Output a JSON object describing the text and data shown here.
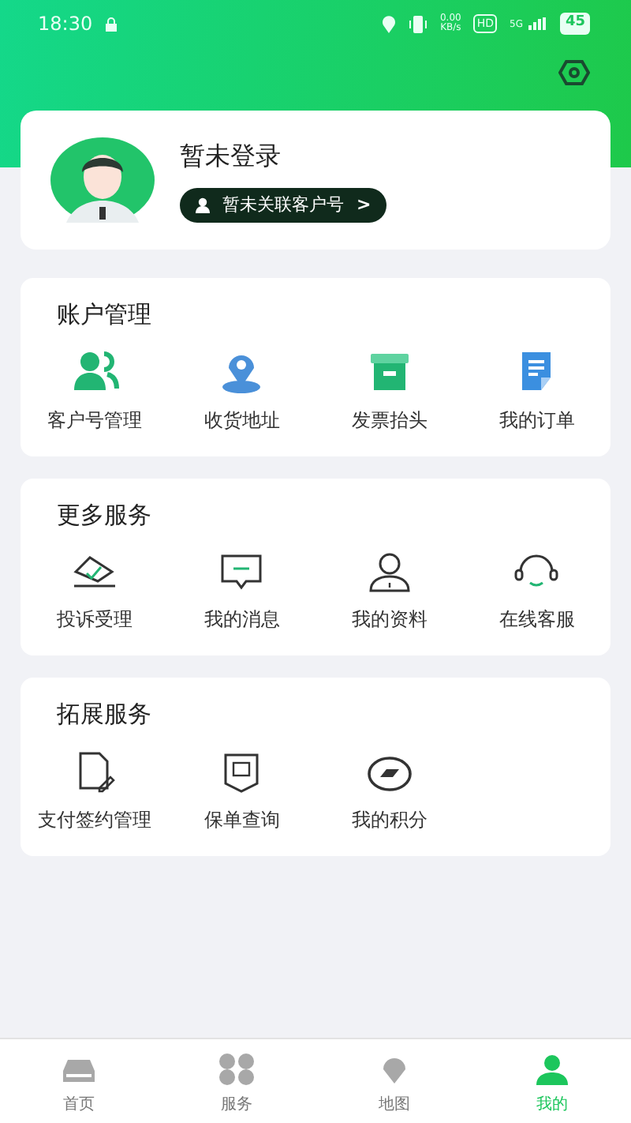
{
  "status_bar": {
    "time": "18:30",
    "net_speed_value": "0.00",
    "net_speed_unit": "KB/s",
    "hd": "HD",
    "network": "5G",
    "battery": "45"
  },
  "profile": {
    "name": "暂未登录",
    "link": "暂未关联客户号",
    "chevron": ">"
  },
  "sections": [
    {
      "title": "账户管理",
      "items": [
        "客户号管理",
        "收货地址",
        "发票抬头",
        "我的订单"
      ]
    },
    {
      "title": "更多服务",
      "items": [
        "投诉受理",
        "我的消息",
        "我的资料",
        "在线客服"
      ]
    },
    {
      "title": "拓展服务",
      "items": [
        "支付签约管理",
        "保单查询",
        "我的积分"
      ]
    }
  ],
  "tabs": [
    {
      "label": "首页",
      "selected": false
    },
    {
      "label": "服务",
      "selected": false
    },
    {
      "label": "地图",
      "selected": false
    },
    {
      "label": "我的",
      "selected": true
    }
  ]
}
